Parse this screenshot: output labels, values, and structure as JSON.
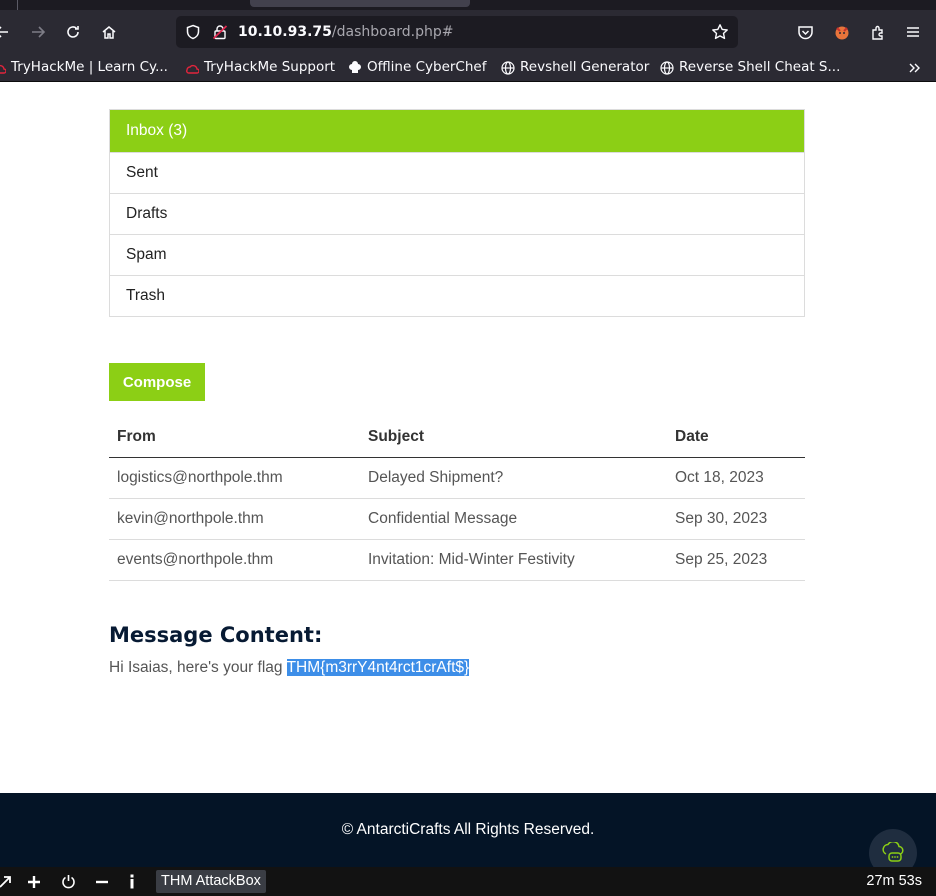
{
  "browser": {
    "url_host": "10.10.93.75",
    "url_path": "/dashboard.php#",
    "bookmarks": [
      {
        "label": "TryHackMe | Learn Cy..."
      },
      {
        "label": "TryHackMe Support"
      },
      {
        "label": "Offline CyberChef"
      },
      {
        "label": "Revshell Generator"
      },
      {
        "label": "Reverse Shell Cheat S..."
      }
    ],
    "overflow_icon": "chevrons-right-icon"
  },
  "mailbox": {
    "folders": [
      {
        "label": "Inbox (3)",
        "active": true
      },
      {
        "label": "Sent"
      },
      {
        "label": "Drafts"
      },
      {
        "label": "Spam"
      },
      {
        "label": "Trash"
      }
    ],
    "compose_label": "Compose",
    "columns": [
      "From",
      "Subject",
      "Date"
    ],
    "rows": [
      {
        "from": "logistics@northpole.thm",
        "subject": "Delayed Shipment?",
        "date": "Oct 18, 2023"
      },
      {
        "from": "kevin@northpole.thm",
        "subject": "Confidential Message",
        "date": "Sep 30, 2023"
      },
      {
        "from": "events@northpole.thm",
        "subject": "Invitation: Mid-Winter Festivity",
        "date": "Sep 25, 2023"
      }
    ]
  },
  "message": {
    "title": "Message Content:",
    "text": "Hi Isaias, here's your flag ",
    "flag": "THM{m3rrY4nt4rct1crAft$}"
  },
  "footer": {
    "copyright": "© AntarctiCrafts All Rights Reserved."
  },
  "taskbar": {
    "app_label": "THM AttackBox",
    "timer": "27m 53s"
  },
  "colors": {
    "accent": "#8ccf15",
    "footer_bg": "#041426",
    "selection": "#3d8ee8"
  }
}
